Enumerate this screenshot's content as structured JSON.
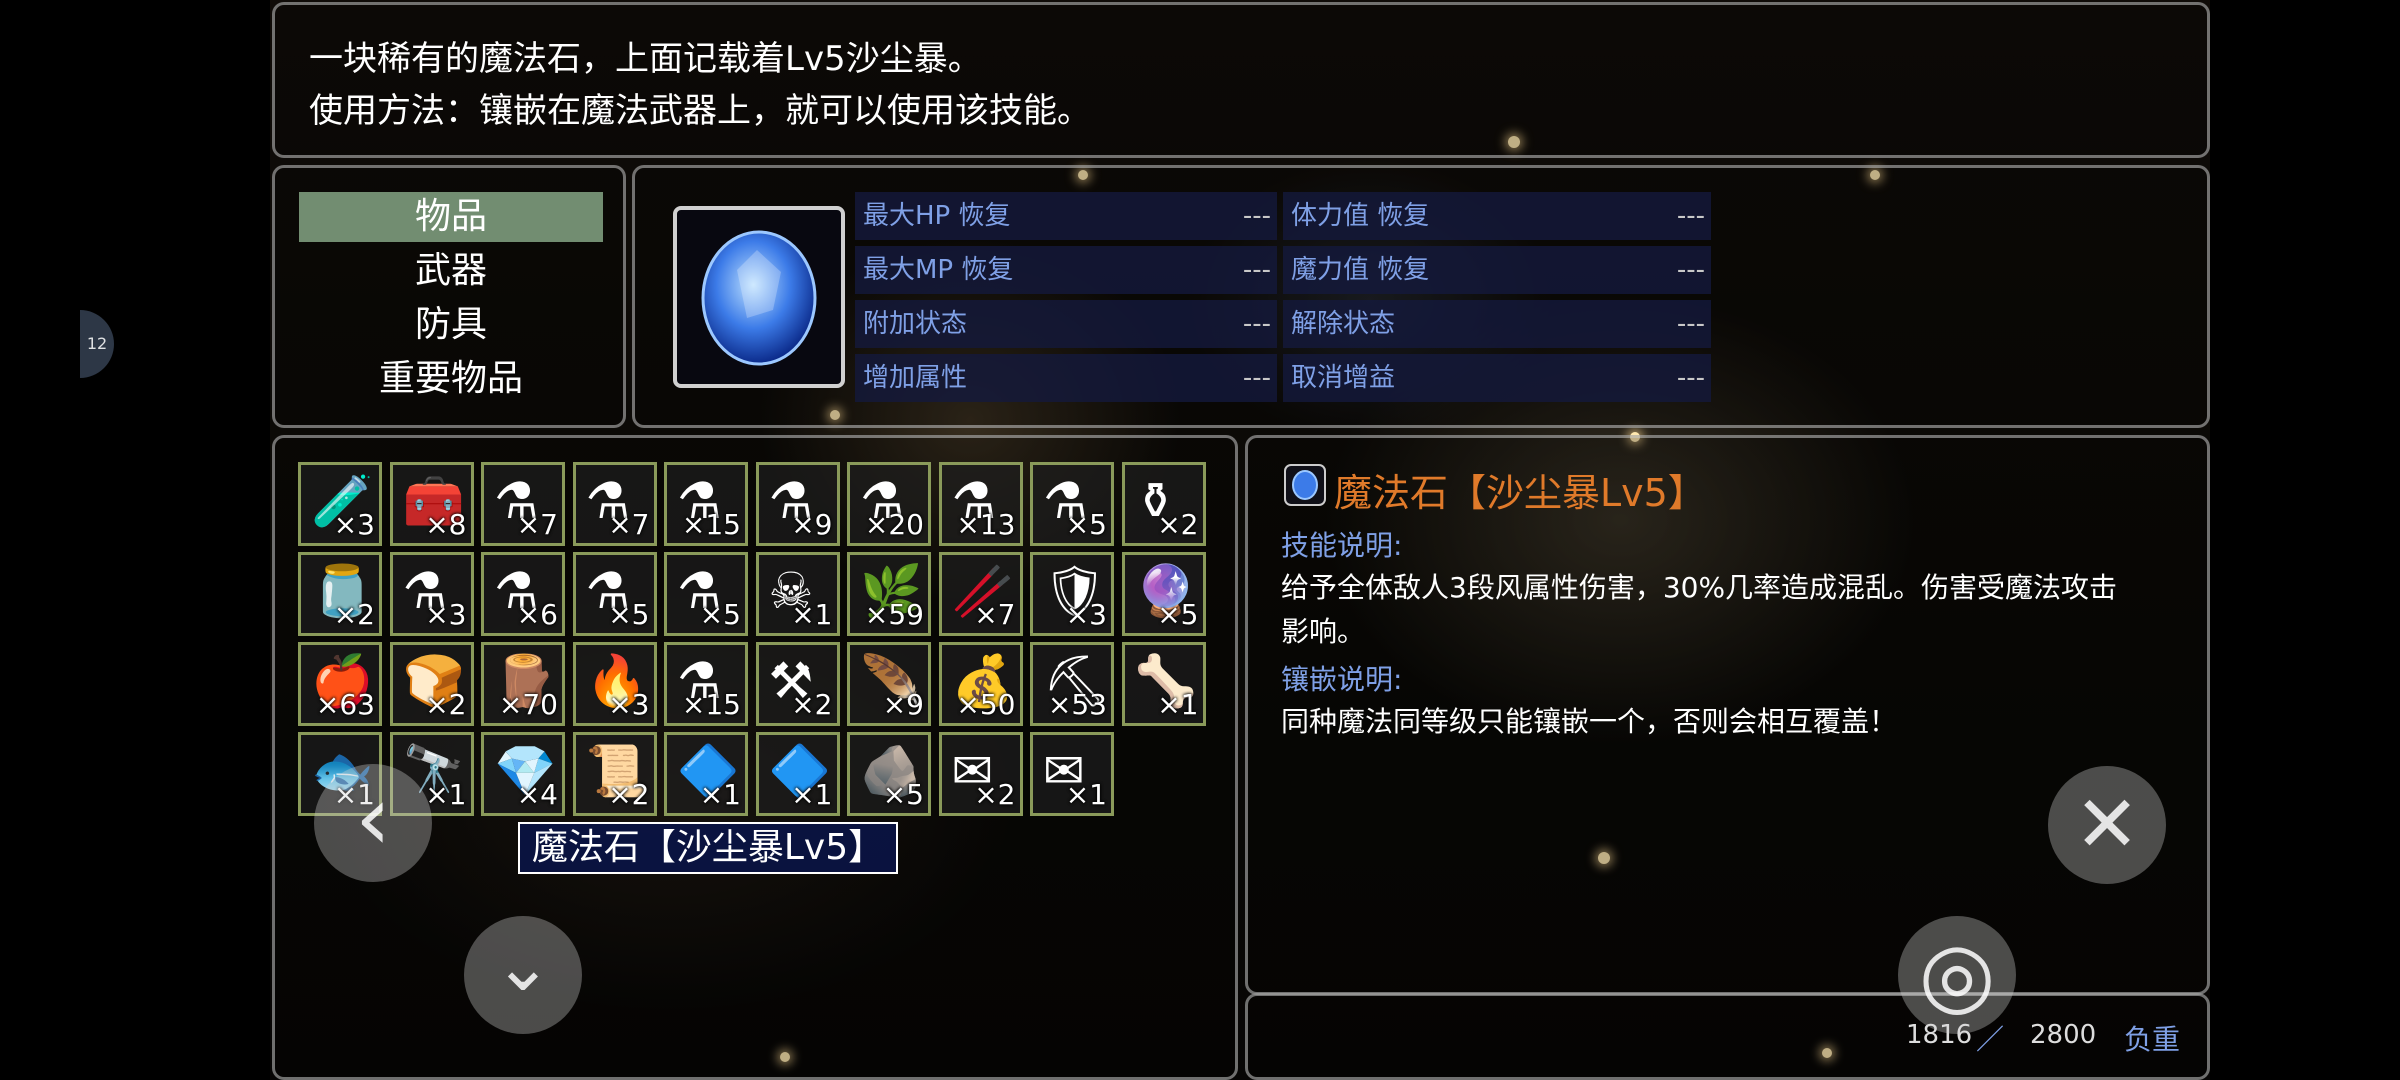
{
  "help": {
    "line1": "一块稀有的魔法石，上面记载着Lv5沙尘暴。",
    "line2": "使用方法：镶嵌在魔法武器上，就可以使用该技能。"
  },
  "categories": [
    "物品",
    "武器",
    "防具",
    "重要物品"
  ],
  "selected_category": "物品",
  "stats": [
    {
      "label": "最大HP 恢复",
      "value": "---"
    },
    {
      "label": "体力值 恢复",
      "value": "---"
    },
    {
      "label": "最大MP 恢复",
      "value": "---"
    },
    {
      "label": "魔力值 恢复",
      "value": "---"
    },
    {
      "label": "附加状态",
      "value": "---"
    },
    {
      "label": "解除状态",
      "value": "---"
    },
    {
      "label": "增加属性",
      "value": "---"
    },
    {
      "label": "取消增益",
      "value": "---"
    }
  ],
  "inventory": [
    {
      "icon": "bottle-icon",
      "glyph": "🧪",
      "count": "×3"
    },
    {
      "icon": "chest-icon",
      "glyph": "🧰",
      "count": "×8"
    },
    {
      "icon": "red-potion-icon",
      "glyph": "⚗",
      "count": "×7"
    },
    {
      "icon": "red-flask-icon",
      "glyph": "⚗",
      "count": "×7"
    },
    {
      "icon": "orange-flask-icon",
      "glyph": "⚗",
      "count": "×15"
    },
    {
      "icon": "blue-potion-icon",
      "glyph": "⚗",
      "count": "×9"
    },
    {
      "icon": "blue-potion-icon",
      "glyph": "⚗",
      "count": "×20"
    },
    {
      "icon": "blue-potion-icon",
      "glyph": "⚗",
      "count": "×13"
    },
    {
      "icon": "blue-flask-icon",
      "glyph": "⚗",
      "count": "×5"
    },
    {
      "icon": "blue-vase-icon",
      "glyph": "⚱",
      "count": "×2"
    },
    {
      "icon": "jar-icon",
      "glyph": "🫙",
      "count": "×2"
    },
    {
      "icon": "grey-flask-icon",
      "glyph": "⚗",
      "count": "×3"
    },
    {
      "icon": "green-flask-icon",
      "glyph": "⚗",
      "count": "×6"
    },
    {
      "icon": "yellow-flask-icon",
      "glyph": "⚗",
      "count": "×5"
    },
    {
      "icon": "teal-flask-icon",
      "glyph": "⚗",
      "count": "×5"
    },
    {
      "icon": "skull-flask-icon",
      "glyph": "☠",
      "count": "×1"
    },
    {
      "icon": "herb-icon",
      "glyph": "🌿",
      "count": "×59"
    },
    {
      "icon": "root-icon",
      "glyph": "🥢",
      "count": "×7"
    },
    {
      "icon": "armor-icon",
      "glyph": "🛡",
      "count": "×3"
    },
    {
      "icon": "blue-orb-icon",
      "glyph": "🔮",
      "count": "×5"
    },
    {
      "icon": "apple-icon",
      "glyph": "🍎",
      "count": "×63"
    },
    {
      "icon": "bread-icon",
      "glyph": "🍞",
      "count": "×2"
    },
    {
      "icon": "plank-icon",
      "glyph": "🪵",
      "count": "×70"
    },
    {
      "icon": "torch-icon",
      "glyph": "🔥",
      "count": "×3"
    },
    {
      "icon": "water-flask-icon",
      "glyph": "⚗",
      "count": "×15"
    },
    {
      "icon": "crowbar-icon",
      "glyph": "⚒",
      "count": "×2"
    },
    {
      "icon": "feather-icon",
      "glyph": "🪶",
      "count": "×9"
    },
    {
      "icon": "gold-bar-icon",
      "glyph": "💰",
      "count": "×50"
    },
    {
      "icon": "pickaxe-icon",
      "glyph": "⛏",
      "count": "×53"
    },
    {
      "icon": "bone-icon",
      "glyph": "🦴",
      "count": "×1"
    },
    {
      "icon": "fish-icon",
      "glyph": "🐟",
      "count": "×1"
    },
    {
      "icon": "spyglass-icon",
      "glyph": "🔭",
      "count": "×1"
    },
    {
      "icon": "crystal-crown-icon",
      "glyph": "💎",
      "count": "×4"
    },
    {
      "icon": "scroll-icon",
      "glyph": "📜",
      "count": "×2"
    },
    {
      "icon": "magic-stone-icon",
      "glyph": "🔷",
      "count": "×1"
    },
    {
      "icon": "magic-stone-icon",
      "glyph": "🔷",
      "count": "×1"
    },
    {
      "icon": "stone-icon",
      "glyph": "🪨",
      "count": "×5"
    },
    {
      "icon": "letter-icon",
      "glyph": "✉",
      "count": "×2"
    },
    {
      "icon": "letter-icon",
      "glyph": "✉",
      "count": "×1"
    }
  ],
  "tooltip": "魔法石【沙尘暴Lv5】",
  "detail": {
    "name": "魔法石【沙尘暴Lv5】",
    "skill_header": "技能说明:",
    "skill_line1": "给予全体敌人3段风属性伤害，30%几率造成混乱。伤害受魔法攻击",
    "skill_line2": "影响。",
    "inlay_header": "镶嵌说明:",
    "inlay_text": "同种魔法同等级只能镶嵌一个，否则会相互覆盖！"
  },
  "footer": {
    "current": "1816",
    "sep": "／",
    "max": "2800",
    "label": "负重"
  },
  "controls": {
    "left": "‹",
    "down": "⌄",
    "close": "✕",
    "confirm": "◎",
    "page": "12"
  },
  "colors": {
    "item_name": "#e07a2a",
    "header": "#7fa0e6",
    "slot_border": "#8a9a5a",
    "selected": "#96b996"
  }
}
